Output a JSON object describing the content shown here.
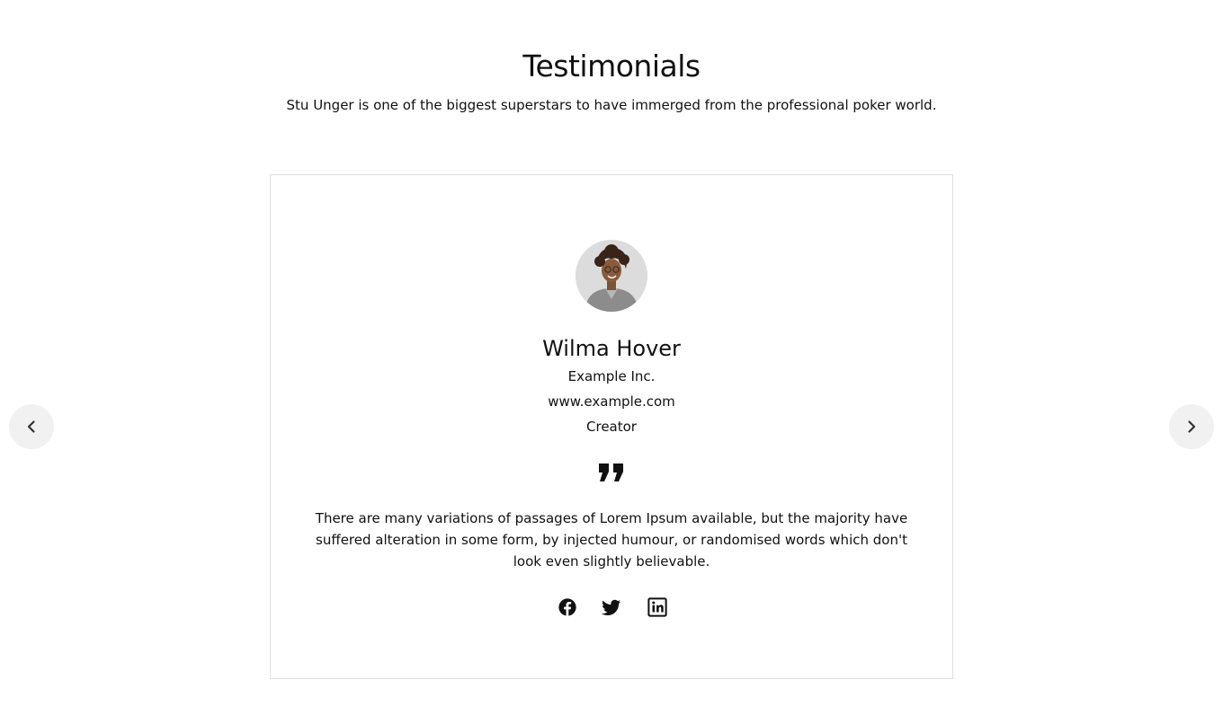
{
  "header": {
    "title": "Testimonials",
    "subtitle": "Stu Unger is one of the biggest superstars to have immerged from the professional poker world."
  },
  "testimonial": {
    "name": "Wilma Hover",
    "company": "Example Inc.",
    "website": "www.example.com",
    "role": "Creator",
    "quote": "There are many variations of passages of Lorem Ipsum available, but the majority have suffered alteration in some form, by injected humour, or randomised words which don't look even slightly believable.",
    "quote_icon": "quote-icon",
    "avatar_icon": "avatar-photo"
  },
  "socials": [
    {
      "name": "Facebook",
      "icon": "facebook-icon"
    },
    {
      "name": "Twitter",
      "icon": "twitter-icon"
    },
    {
      "name": "LinkedIn",
      "icon": "linkedin-icon"
    }
  ],
  "navigation": {
    "prev_icon": "chevron-left-icon",
    "next_icon": "chevron-right-icon"
  },
  "colors": {
    "text": "#111111",
    "card_border": "#dedede",
    "nav_background": "#f1f1f1",
    "background": "#ffffff"
  }
}
